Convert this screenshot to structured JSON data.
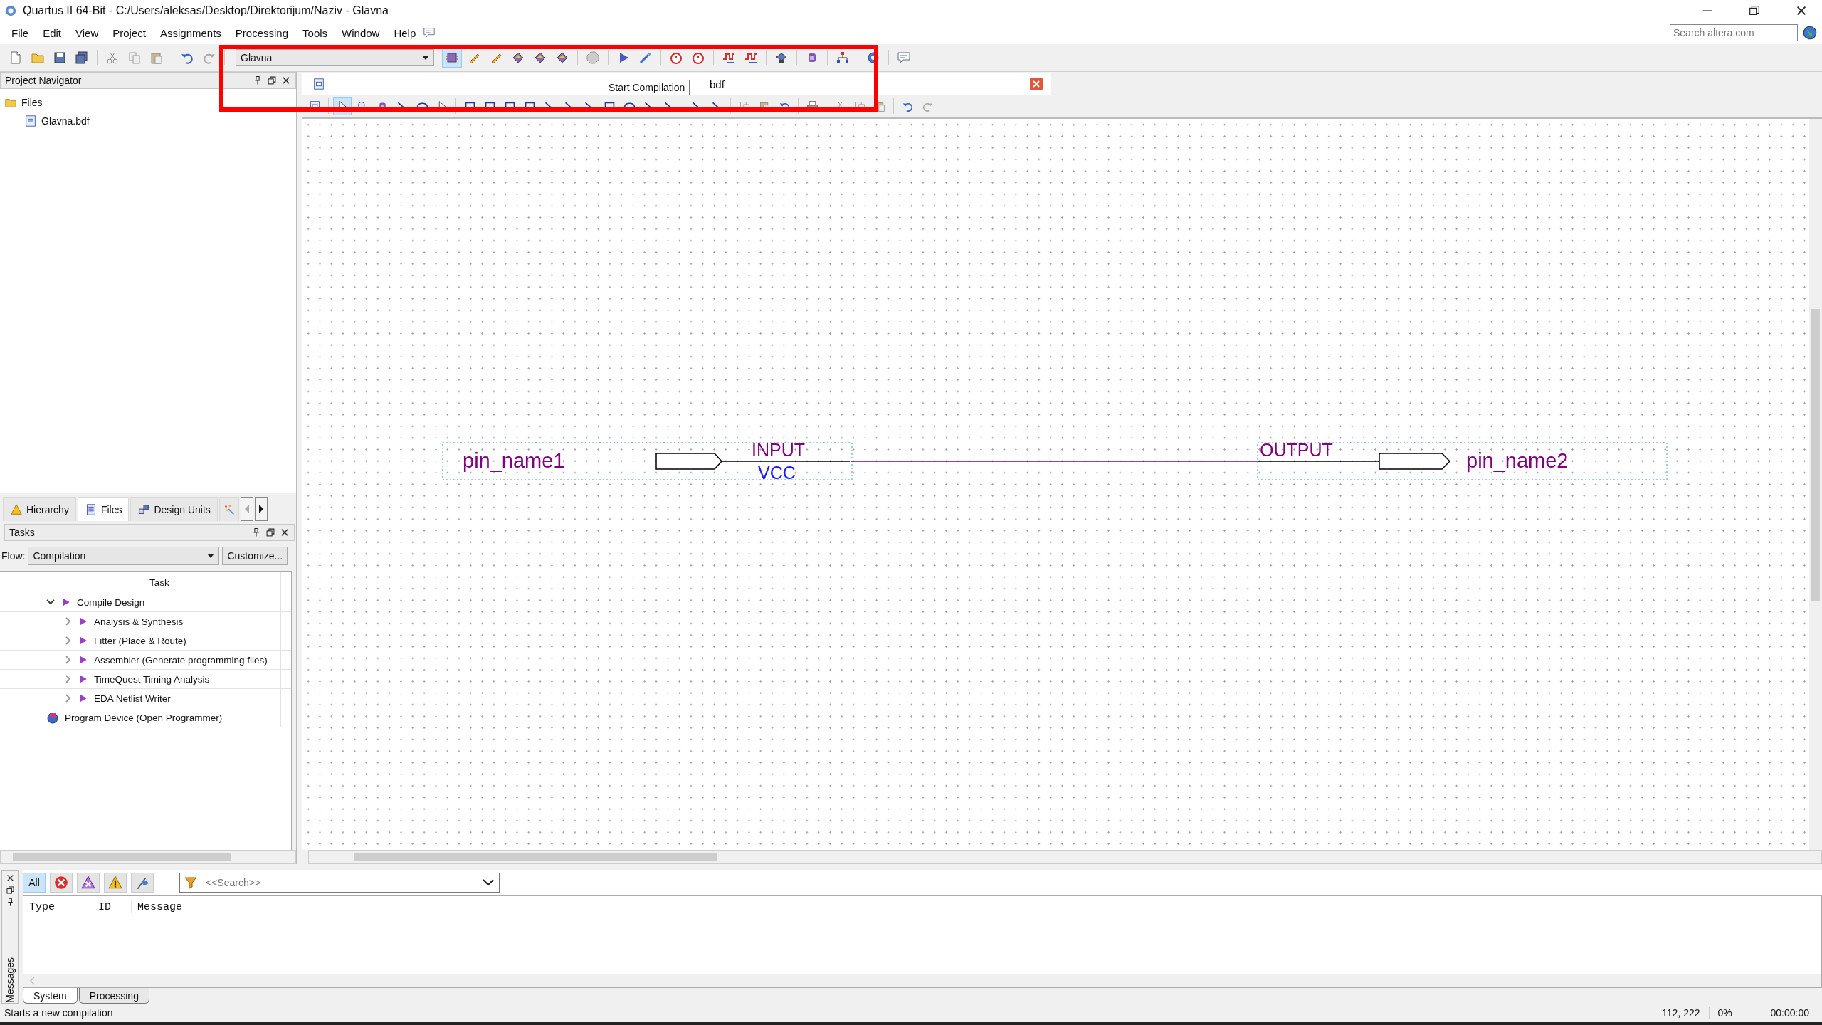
{
  "window": {
    "title": "Quartus II 64-Bit - C:/Users/aleksas/Desktop/Direktorijum/Naziv - Glavna"
  },
  "menu": [
    "File",
    "Edit",
    "View",
    "Project",
    "Assignments",
    "Processing",
    "Tools",
    "Window",
    "Help"
  ],
  "web_search": {
    "placeholder": "Search altera.com"
  },
  "toolbar": {
    "project_dropdown": "Glavna",
    "tooltip": "Start Compilation"
  },
  "project_navigator": {
    "title": "Project Navigator",
    "tree": [
      {
        "label": "Files",
        "kind": "folder",
        "children": [
          {
            "label": "Glavna.bdf",
            "kind": "file"
          }
        ]
      }
    ]
  },
  "navigator_tabs": [
    {
      "label": "Hierarchy",
      "kind": "hierarchy",
      "selected": false
    },
    {
      "label": "Files",
      "kind": "files",
      "selected": true
    },
    {
      "label": "Design Units",
      "kind": "units",
      "selected": false
    },
    {
      "kind": "more",
      "selected": false
    }
  ],
  "tasks": {
    "title": "Tasks",
    "flow_label": "Flow:",
    "flow": "Compilation",
    "customize": "Customize...",
    "column": "Task",
    "items": [
      {
        "label": "Compile Design",
        "kind": "step",
        "expanded": true,
        "children": [
          {
            "label": "Analysis & Synthesis",
            "kind": "step",
            "expanded": false
          },
          {
            "label": "Fitter (Place & Route)",
            "kind": "step",
            "expanded": false
          },
          {
            "label": "Assembler (Generate programming files)",
            "kind": "step",
            "expanded": false
          },
          {
            "label": "TimeQuest Timing Analysis",
            "kind": "step",
            "expanded": false
          },
          {
            "label": "EDA Netlist Writer",
            "kind": "step",
            "expanded": false
          }
        ]
      },
      {
        "label": "Program Device (Open Programmer)",
        "kind": "program"
      }
    ]
  },
  "document_tab": {
    "label": "bdf"
  },
  "schematic": {
    "input_pin": {
      "name": "pin_name1",
      "type": "INPUT",
      "default": "VCC"
    },
    "output_pin": {
      "name": "pin_name2",
      "type": "OUTPUT"
    }
  },
  "messages": {
    "panel_label": "Messages",
    "filters": [
      {
        "label": "All",
        "kind": "all",
        "selected": true
      },
      {
        "kind": "error",
        "selected": false
      },
      {
        "kind": "critical",
        "selected": false
      },
      {
        "kind": "warning",
        "selected": false
      },
      {
        "kind": "flag",
        "selected": false
      }
    ],
    "search_placeholder": "<<Search>>",
    "columns": [
      "Type",
      "ID",
      "Message"
    ],
    "tabs": [
      {
        "label": "System",
        "selected": true
      },
      {
        "label": "Processing",
        "selected": false
      }
    ]
  },
  "status_bar": {
    "text": "Starts a new compilation",
    "coordinates": "112, 222",
    "progress": "0%",
    "time": "00:00:00"
  }
}
